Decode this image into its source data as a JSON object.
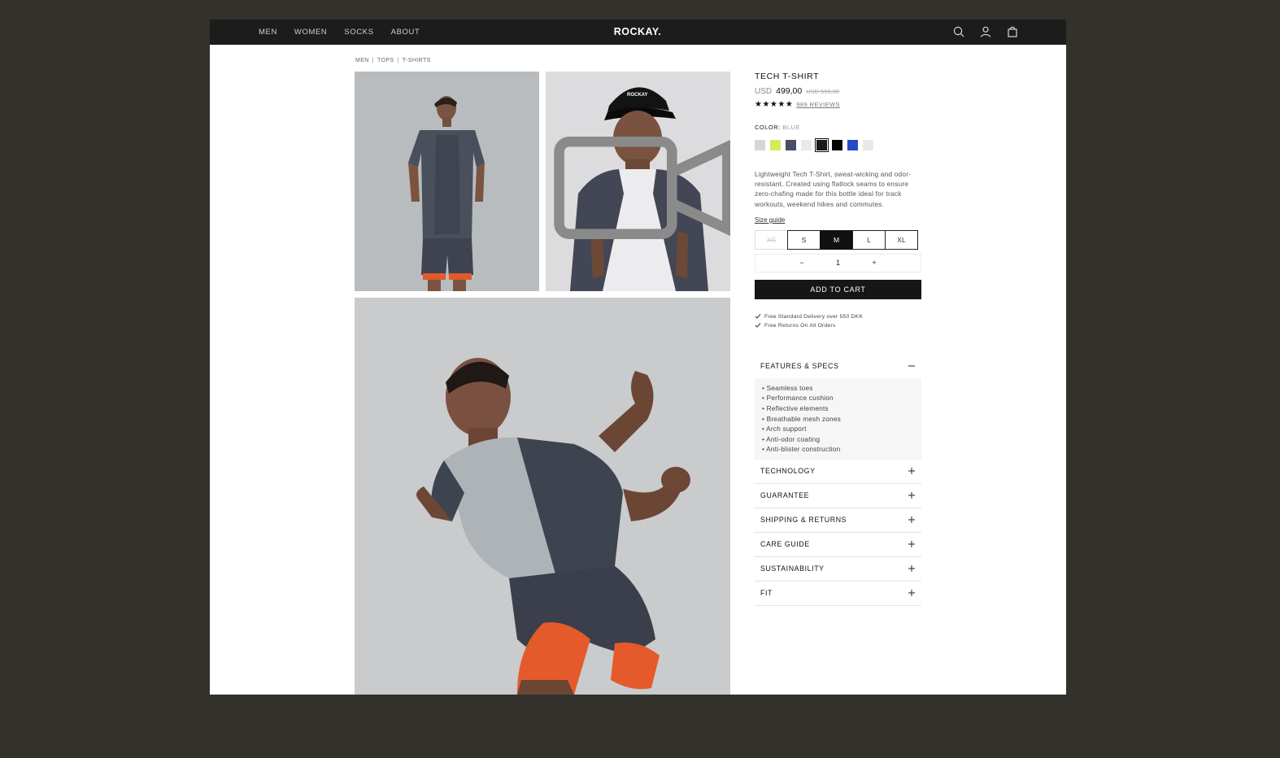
{
  "nav": {
    "links": [
      "MEN",
      "WOMEN",
      "SOCKS",
      "ABOUT"
    ],
    "logo": "ROCKAY.",
    "icons": [
      "search-icon",
      "account-icon",
      "bag-icon"
    ]
  },
  "breadcrumb": [
    "MEN",
    "TOPS",
    "T-SHIRTS"
  ],
  "gallery": {
    "images": [
      "back-view-photo",
      "cap-portrait-photo",
      "running-photo"
    ],
    "video_icon": "video-icon"
  },
  "product": {
    "title": "TECH T-SHIRT",
    "currency": "USD",
    "price": "499,00",
    "old_price": "USD 550,00",
    "stars": "★★★★★",
    "reviews": "989 REVIEWS",
    "color_label": "COLOR:",
    "color_value": "BLUE",
    "swatches": [
      "#d6d6d6",
      "#d6ea5a",
      "#4a4e63",
      "#e9e9ee",
      "#1a1a1a",
      "#050505",
      "#2549c4",
      "#e6e9ee"
    ],
    "selected_swatch_index": 4,
    "description": "Lightweight Tech T-Shirt, sweat-wicking and odor-resistant. Created using flatlock seams to ensure zero-chafing made for this bottle ideal for track workouts, weekend hikes and commutes.",
    "size_guide": "Size guide",
    "sizes": [
      "XS",
      "S",
      "M",
      "L",
      "XL"
    ],
    "selected_size": "M",
    "quantity": "1",
    "qty_minus": "−",
    "qty_plus": "+",
    "add_to_cart": "ADD TO CART",
    "perks": [
      "Free Standard Delivery over 550 DKK",
      "Free Returns On All Orders"
    ]
  },
  "accordion": {
    "open": {
      "title": "FEATURES & SPECS",
      "items": [
        "• Seamless toes",
        "• Performance cushion",
        "• Reflective elements",
        "• Breathable mesh zones",
        "• Arch support",
        "• Anti-odor coating",
        "• Anti-blister construction"
      ]
    },
    "closed": [
      "TECHNOLOGY",
      "GUARANTEE",
      "SHIPPING & RETURNS",
      "CARE GUIDE",
      "SUSTAINABILITY",
      "FIT"
    ]
  },
  "colors": {
    "nav_bg": "#1c1c1c",
    "page_bg": "#32312b",
    "button_bg": "#161616",
    "shorts_accent": "#e85a2c"
  }
}
